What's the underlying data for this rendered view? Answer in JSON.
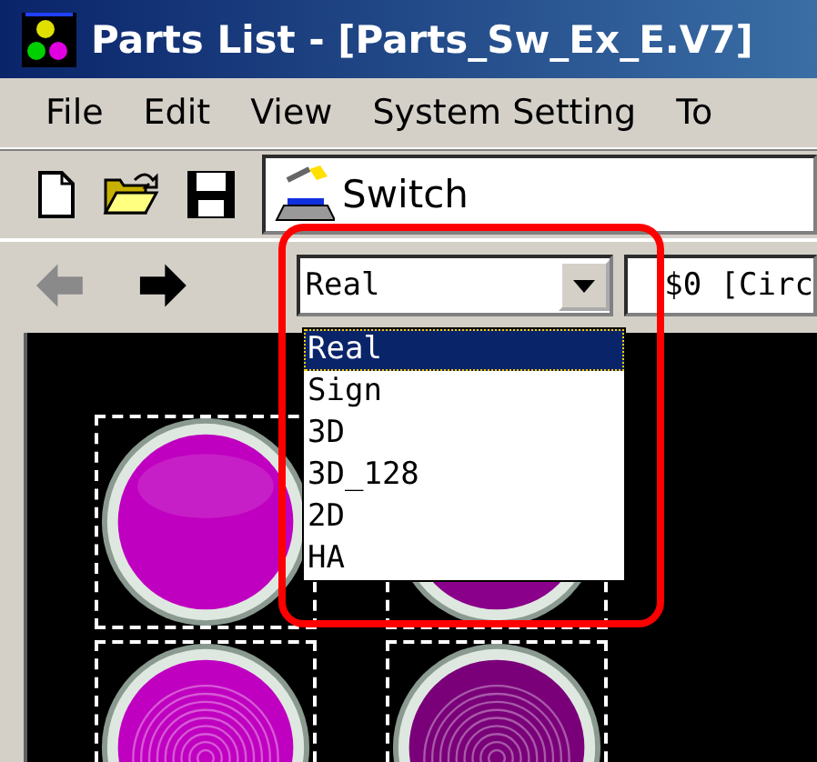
{
  "window": {
    "title": "Parts List - [Parts_Sw_Ex_E.V7]"
  },
  "menu": [
    {
      "label": "File"
    },
    {
      "label": "Edit"
    },
    {
      "label": "View"
    },
    {
      "label": "System Setting"
    },
    {
      "label": "To"
    }
  ],
  "toolbar": {
    "part_type": "Switch"
  },
  "nav": [
    {
      "kind": "back",
      "disabled": true
    },
    {
      "kind": "forward",
      "disabled": false
    }
  ],
  "style_combo": {
    "value": "Real",
    "options": [
      {
        "label": "Real",
        "selected": true
      },
      {
        "label": "Sign",
        "selected": false
      },
      {
        "label": "3D",
        "selected": false
      },
      {
        "label": "3D_128",
        "selected": false
      },
      {
        "label": "2D",
        "selected": false
      },
      {
        "label": "HA",
        "selected": false
      }
    ]
  },
  "part_field": {
    "value": "$0 [Circ"
  },
  "parts": [
    {
      "kind": "plain",
      "color": "#c000c0"
    },
    {
      "kind": "plain",
      "color": "#8a008a"
    },
    {
      "kind": "rings",
      "color": "#c000c0"
    },
    {
      "kind": "rings",
      "color": "#7a007a"
    }
  ]
}
